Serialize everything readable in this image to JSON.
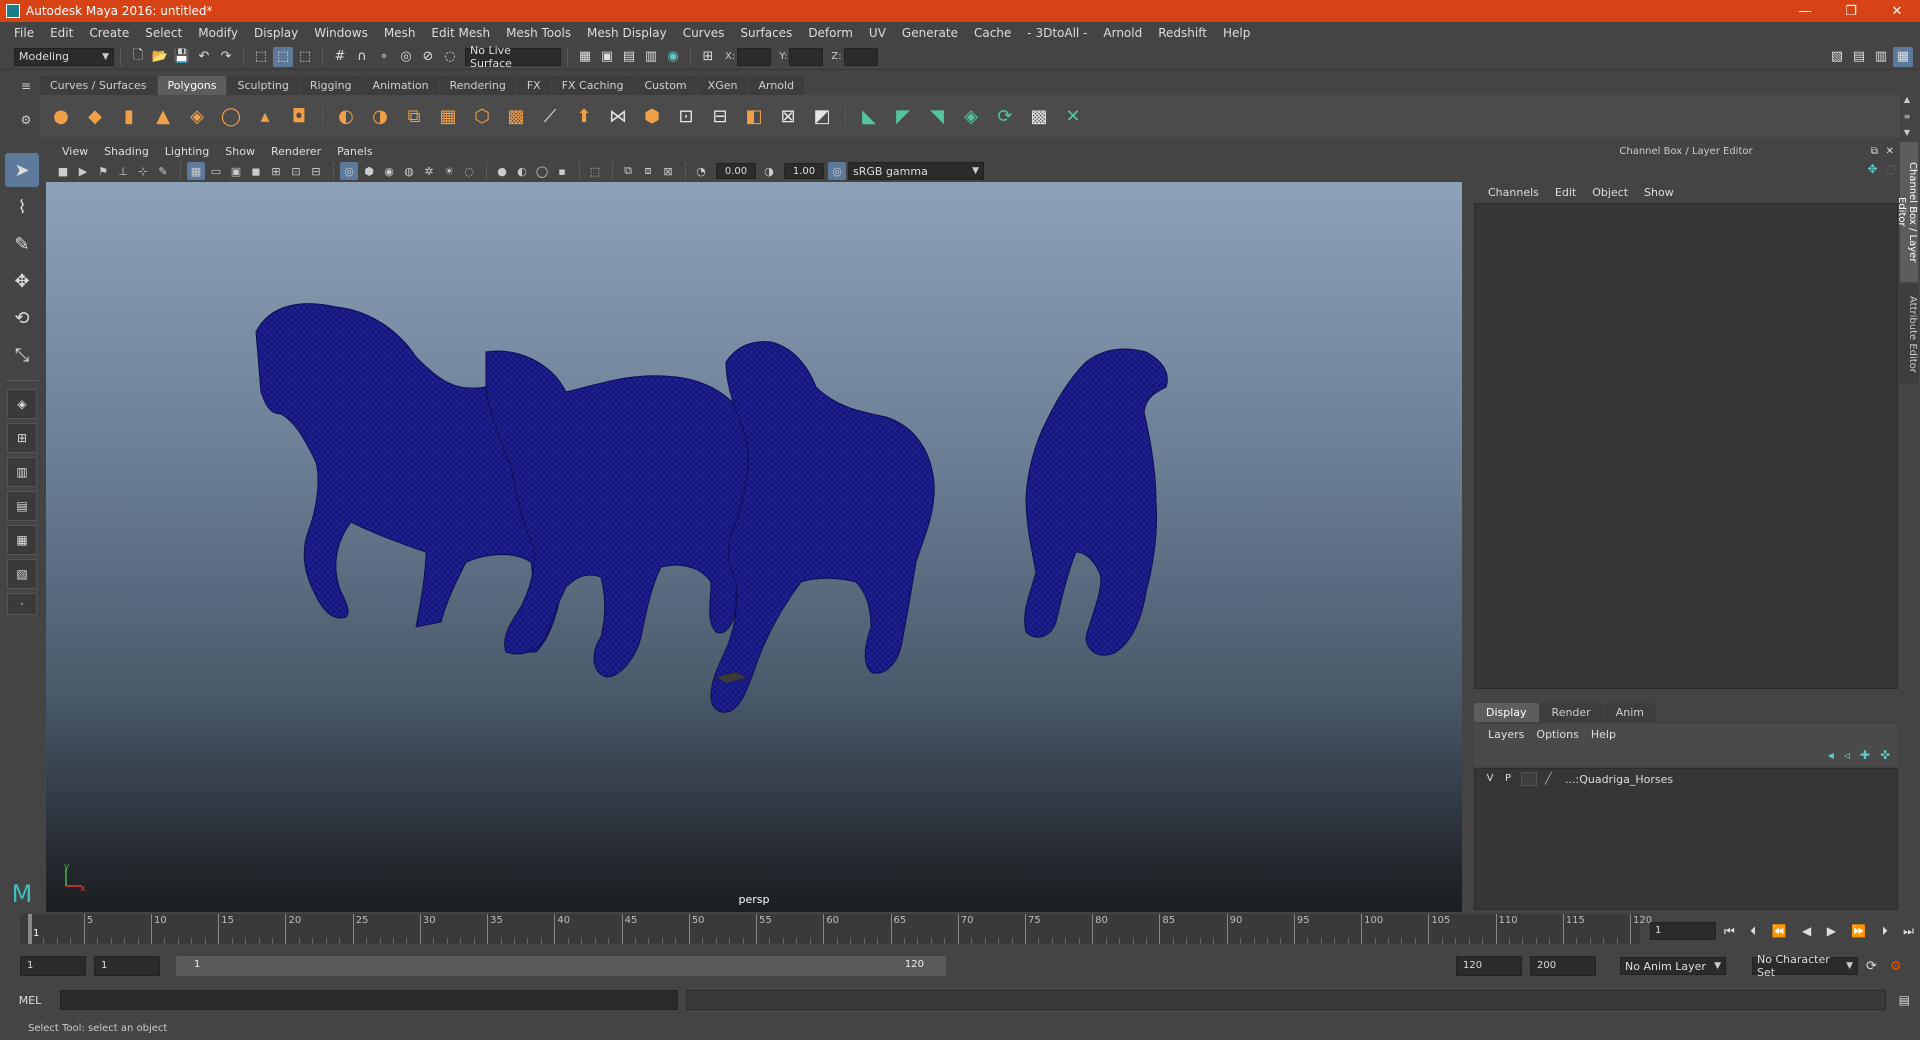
{
  "window": {
    "title": "Autodesk Maya 2016: untitled*",
    "minimize": "—",
    "maximize": "❐",
    "close": "✕"
  },
  "menubar": [
    "File",
    "Edit",
    "Create",
    "Select",
    "Modify",
    "Display",
    "Windows",
    "Mesh",
    "Edit Mesh",
    "Mesh Tools",
    "Mesh Display",
    "Curves",
    "Surfaces",
    "Deform",
    "UV",
    "Generate",
    "Cache",
    "- 3DtoAll -",
    "Arnold",
    "Redshift",
    "Help"
  ],
  "statusline": {
    "mode": "Modeling",
    "live_surface": "No Live Surface",
    "x_label": "X:",
    "y_label": "Y:",
    "z_label": "Z:"
  },
  "shelf_tabs": [
    "Curves / Surfaces",
    "Polygons",
    "Sculpting",
    "Rigging",
    "Animation",
    "Rendering",
    "FX",
    "FX Caching",
    "Custom",
    "XGen",
    "Arnold"
  ],
  "shelf_active": "Polygons",
  "panel_menu": [
    "View",
    "Shading",
    "Lighting",
    "Show",
    "Renderer",
    "Panels"
  ],
  "panel_tools": {
    "exposure": "0.00",
    "gamma": "1.00",
    "color_space": "sRGB gamma"
  },
  "viewport": {
    "camera": "persp",
    "axis_x": "x",
    "axis_y": "y",
    "bg_top": "#8da2b8",
    "bg_bottom": "#1b1e22",
    "mesh_color": "#14147a"
  },
  "channel_box": {
    "title": "Channel Box / Layer Editor",
    "menu": [
      "Channels",
      "Edit",
      "Object",
      "Show"
    ]
  },
  "layer_editor": {
    "tabs": [
      "Display",
      "Render",
      "Anim"
    ],
    "active_tab": "Display",
    "menu": [
      "Layers",
      "Options",
      "Help"
    ],
    "layers": [
      {
        "v": "V",
        "p": "P",
        "name": "...:Quadriga_Horses"
      }
    ]
  },
  "side_tabs": [
    "Channel Box / Layer Editor",
    "Attribute Editor"
  ],
  "timeline": {
    "ticks": [
      "1",
      "5",
      "10",
      "15",
      "20",
      "25",
      "30",
      "35",
      "40",
      "45",
      "50",
      "55",
      "60",
      "65",
      "70",
      "75",
      "80",
      "85",
      "90",
      "95",
      "100",
      "105",
      "110",
      "115",
      "120"
    ],
    "current_frame": "1"
  },
  "range": {
    "start": "1",
    "playback_start": "1",
    "slider_start": "1",
    "slider_end": "120",
    "playback_end": "120",
    "end": "200",
    "anim_layer": "No Anim Layer",
    "character_set": "No Character Set"
  },
  "mel": {
    "label": "MEL"
  },
  "helpline": "Select Tool: select an object"
}
